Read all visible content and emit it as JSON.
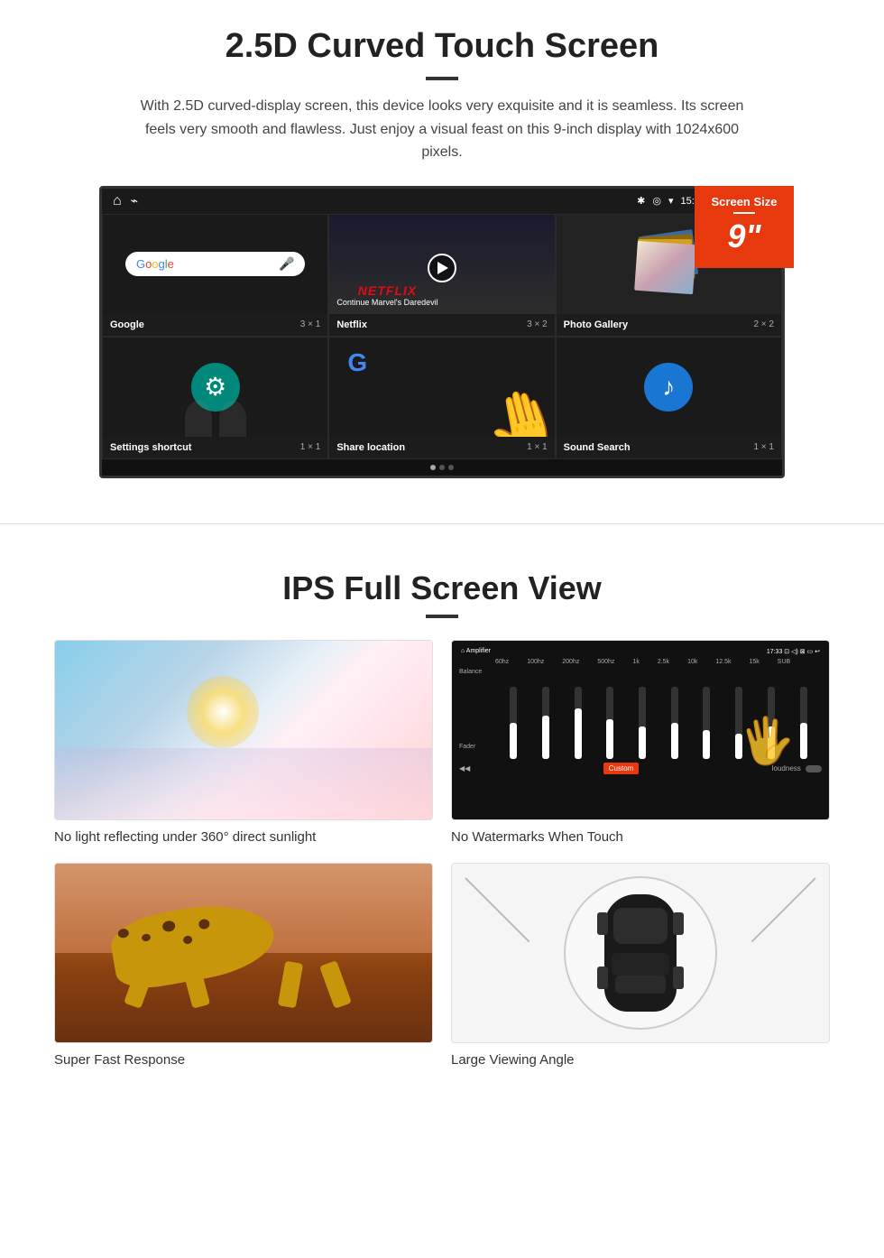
{
  "section1": {
    "title": "2.5D Curved Touch Screen",
    "description": "With 2.5D curved-display screen, this device looks very exquisite and it is seamless. Its screen feels very smooth and flawless. Just enjoy a visual feast on this 9-inch display with 1024x600 pixels.",
    "screen_badge": {
      "label": "Screen Size",
      "size": "9\""
    },
    "status_bar": {
      "time": "15:06"
    },
    "apps": [
      {
        "name": "Google",
        "size": "3 × 1"
      },
      {
        "name": "Netflix",
        "size": "3 × 2"
      },
      {
        "name": "Photo Gallery",
        "size": "2 × 2"
      },
      {
        "name": "Settings shortcut",
        "size": "1 × 1"
      },
      {
        "name": "Share location",
        "size": "1 × 1"
      },
      {
        "name": "Sound Search",
        "size": "1 × 1"
      }
    ],
    "netflix": {
      "brand": "NETFLIX",
      "subtitle": "Continue Marvel's Daredevil"
    }
  },
  "section2": {
    "title": "IPS Full Screen View",
    "features": [
      {
        "label": "No light reflecting under 360° direct sunlight"
      },
      {
        "label": "No Watermarks When Touch"
      },
      {
        "label": "Super Fast Response"
      },
      {
        "label": "Large Viewing Angle"
      }
    ]
  }
}
